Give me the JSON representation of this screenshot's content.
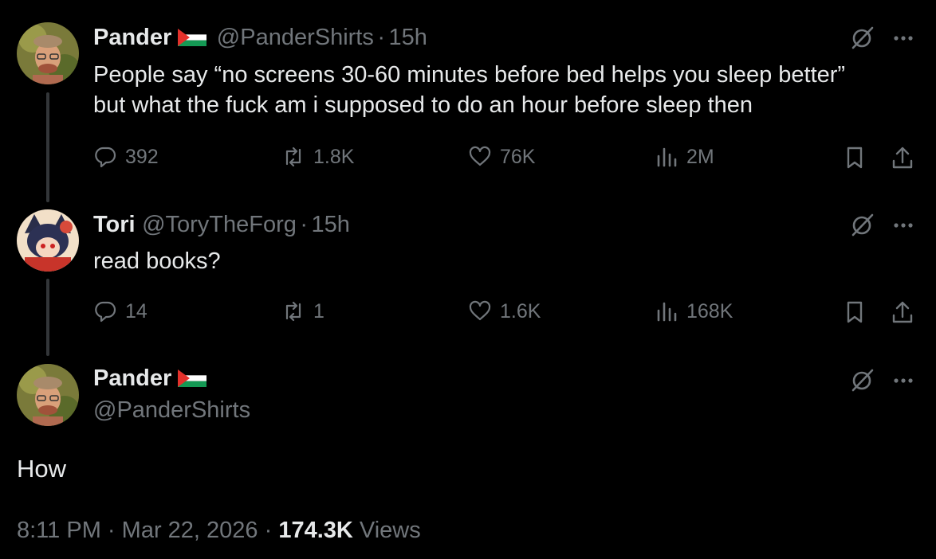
{
  "tweet1": {
    "name": "Pander",
    "handle": "@PanderShirts",
    "separator": "·",
    "time": "15h",
    "text_line1": "People say “no screens 30-60 minutes before bed helps you sleep better”",
    "text_line2": "but what the fuck am i supposed to do an hour before sleep then",
    "replies": "392",
    "reposts": "1.8K",
    "likes": "76K",
    "views": "2M"
  },
  "tweet2": {
    "name": "Tori",
    "handle": "@ToryTheForg",
    "separator": "·",
    "time": "15h",
    "text": "read books?",
    "replies": "14",
    "reposts": "1",
    "likes": "1.6K",
    "views": "168K"
  },
  "tweet3": {
    "name": "Pander",
    "handle": "@PanderShirts",
    "text": "How",
    "time": "8:11 PM",
    "separator": "·",
    "date": "Mar 22, 2026",
    "views_count": "174.3K",
    "views_label": "Views"
  },
  "icons": {
    "reply": "reply-icon",
    "repost": "repost-icon",
    "like": "heart-icon",
    "views": "views-icon",
    "bookmark": "bookmark-icon",
    "share": "share-icon",
    "grok": "grok-icon",
    "more": "more-icon",
    "flag": "palestine-flag-icon"
  },
  "colors": {
    "background": "#000000",
    "text_primary": "#e7e9ea",
    "text_secondary": "#71767b",
    "thread_line": "#333639"
  }
}
